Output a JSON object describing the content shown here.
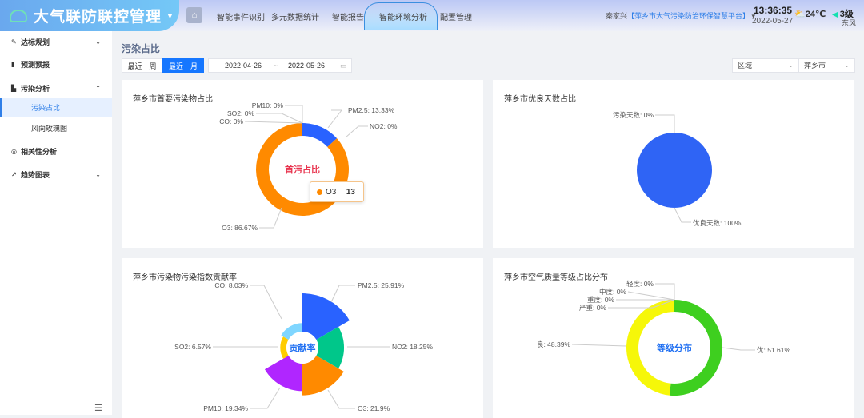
{
  "header": {
    "app_title": "大气联防联控管理",
    "nav": [
      "智能事件识别",
      "多元数据统计",
      "智能报告",
      "智能环境分析",
      "配置管理"
    ],
    "active_nav": "智能环境分析",
    "user": "秦家兴",
    "platform": "【萍乡市大气污染防治环保智慧平台】",
    "time": "13:36:35",
    "date": "2022-05-27",
    "temperature": "24℃",
    "wind_level": "3级",
    "wind_dir": "东风",
    "weather_icon": "partly-cloudy-icon"
  },
  "sidebar": {
    "items": [
      {
        "label": "达标规划",
        "icon": "pen-icon"
      },
      {
        "label": "预测预报",
        "icon": "bar-chart-icon"
      },
      {
        "label": "污染分析",
        "icon": "factory-icon"
      },
      {
        "label": "污染占比",
        "active": true
      },
      {
        "label": "风向玫瑰图"
      },
      {
        "label": "相关性分析",
        "icon": "atom-icon"
      },
      {
        "label": "趋势图表",
        "icon": "line-chart-icon"
      }
    ]
  },
  "page": {
    "title": "污染占比",
    "btn_week": "最近一周",
    "btn_month": "最近一月",
    "start_date": "2022-04-26",
    "sep": "~",
    "end_date": "2022-05-26",
    "select_type": "区域",
    "select_city": "萍乡市"
  },
  "accent": "#1677ff",
  "chart_data": [
    {
      "type": "pie",
      "title": "萍乡市首要污染物占比",
      "center_label": "首污占比",
      "donut": true,
      "categories": [
        "PM2.5",
        "NO2",
        "O3",
        "PM10",
        "SO2",
        "CO"
      ],
      "values": [
        13.33,
        0,
        86.67,
        0,
        0,
        0
      ],
      "labels": [
        "PM2.5: 13.33%",
        "NO2: 0%",
        "O3: 86.67%",
        "PM10: 0%",
        "SO2: 0%",
        "CO: 0%"
      ],
      "colors": [
        "#2962ff",
        "#00c78a",
        "#ff8a00",
        "#b026ff",
        "#ffcc00",
        "#7fd6ff"
      ],
      "tooltip": {
        "name": "O3",
        "value": "13"
      }
    },
    {
      "type": "pie",
      "title": "萍乡市优良天数占比",
      "categories": [
        "污染天数",
        "优良天数"
      ],
      "values": [
        0,
        100
      ],
      "labels": [
        "污染天数: 0%",
        "优良天数: 100%"
      ],
      "colors": [
        "#ff8a00",
        "#2f64f5"
      ]
    },
    {
      "type": "pie",
      "title": "萍乡市污染物污染指数贡献率",
      "center_label": "贡献率",
      "rose": true,
      "categories": [
        "PM2.5",
        "NO2",
        "O3",
        "PM10",
        "SO2",
        "CO"
      ],
      "values": [
        25.91,
        18.25,
        21.9,
        19.34,
        6.57,
        8.03
      ],
      "labels": [
        "PM2.5: 25.91%",
        "NO2: 18.25%",
        "O3: 21.9%",
        "PM10: 19.34%",
        "SO2: 6.57%",
        "CO: 8.03%"
      ],
      "colors": [
        "#2962ff",
        "#00c78a",
        "#ff8a00",
        "#b026ff",
        "#ffcc00",
        "#7fd6ff"
      ]
    },
    {
      "type": "pie",
      "title": "萍乡市空气质量等级占比分布",
      "center_label": "等级分布",
      "donut": true,
      "categories": [
        "优",
        "良",
        "轻度",
        "中度",
        "重度",
        "严重"
      ],
      "values": [
        51.61,
        48.39,
        0,
        0,
        0,
        0
      ],
      "labels": [
        "优: 51.61%",
        "良: 48.39%",
        "轻度: 0%",
        "中度: 0%",
        "重度: 0%",
        "严重: 0%"
      ],
      "colors": [
        "#3ecf1f",
        "#f6f709",
        "#ff8a00",
        "#ff4d4f",
        "#b026ff",
        "#8b0000"
      ]
    }
  ]
}
